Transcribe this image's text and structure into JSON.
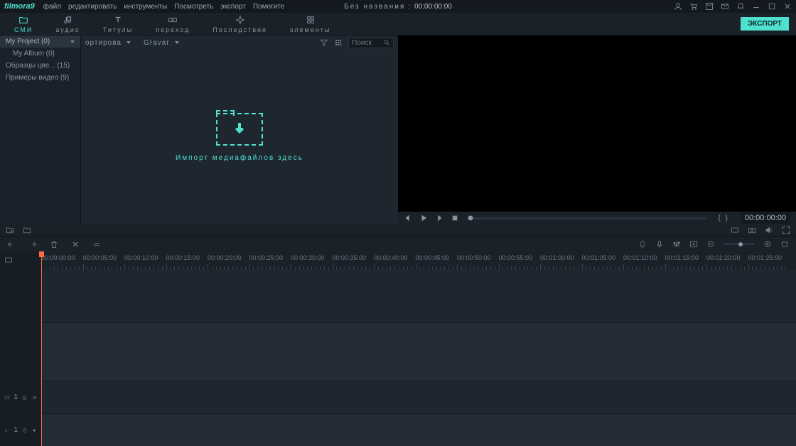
{
  "brand": "filmora9",
  "menu": {
    "file": "файл",
    "edit": "редактировать",
    "tools": "инструменты",
    "view": "Посмотреть",
    "export": "экспорт",
    "help": "Помогите"
  },
  "title": {
    "name": "Без названия",
    "time": "00:00:00:00"
  },
  "tabs": {
    "media": "СМИ",
    "audio": "аудио",
    "titles": "Титулы",
    "transition": "переход",
    "effects": "Последствия",
    "elements": "элементы"
  },
  "export_btn": "ЭКСПОРТ",
  "folders": {
    "my_project": "My Project (0)",
    "my_album": "My Album (0)",
    "samples": "Образцы цве... (15)",
    "examples": "Примеры видео (9)"
  },
  "media_toolbar": {
    "import": "ортирова",
    "record": "Gravar"
  },
  "search": {
    "placeholder": "Поиск"
  },
  "dropzone": {
    "text": "Импорт медиафайлов здесь"
  },
  "preview": {
    "time": "00:00:00:00",
    "markers": "{  }"
  },
  "timeline": {
    "ticks": [
      "00:00:00:00",
      "00:00:05:00",
      "00:00:10:00",
      "00:00:15:00",
      "00:00:20:00",
      "00:00:25:00",
      "00:00:30:00",
      "00:00:35:00",
      "00:00:40:00",
      "00:00:45:00",
      "00:00:50:00",
      "00:00:55:00",
      "00:01:00:00",
      "00:01:05:00",
      "00:01:10:00",
      "00:01:15:00",
      "00:01:20:00",
      "00:01:25:00"
    ]
  },
  "tracks": {
    "video1": "1",
    "audio1": "1"
  }
}
